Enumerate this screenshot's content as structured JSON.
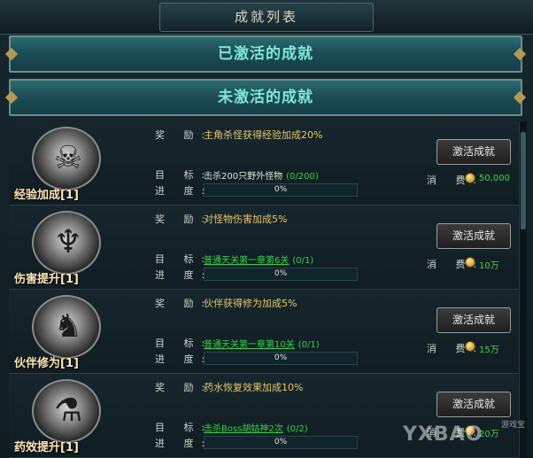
{
  "window": {
    "title": "成就列表"
  },
  "sections": {
    "activated": "已激活的成就",
    "inactive": "未激活的成就"
  },
  "labels": {
    "reward": "奖 励:",
    "target": "目 标:",
    "progress": "进 度:",
    "cost": "消 费:"
  },
  "achievements": [
    {
      "name": "经验加成[1]",
      "icon": "skull-medal-icon",
      "reward": "主角杀怪获得经验加成20%",
      "target": "击杀200只野外怪物",
      "target_link": false,
      "count": "(0/200)",
      "progress_text": "0%",
      "progress": 0,
      "button": "激活成就",
      "cost": "50,000"
    },
    {
      "name": "伤害提升[1]",
      "icon": "trident-medal-icon",
      "reward": "对怪物伤害加成5%",
      "target": "普通天关第一章第6关",
      "target_link": true,
      "count": "(0/1)",
      "progress_text": "0%",
      "progress": 0,
      "button": "激活成就",
      "cost": "10万"
    },
    {
      "name": "伙伴修为[1]",
      "icon": "companion-medal-icon",
      "reward": "伙伴获得修为加成5%",
      "target": "普通天关第一章第10关",
      "target_link": true,
      "count": "(0/1)",
      "progress_text": "0%",
      "progress": 0,
      "button": "激活成就",
      "cost": "15万"
    },
    {
      "name": "药效提升[1]",
      "icon": "potion-medal-icon",
      "reward": "药水恢复效果加成10%",
      "target": "击杀Boss胡姑神2次",
      "target_link": true,
      "count": "(0/2)",
      "progress_text": "0%",
      "progress": 0,
      "button": "激活成就",
      "cost": "20万"
    }
  ],
  "watermark": {
    "text": "YXBAO",
    "sub": "游戏宝"
  },
  "colors": {
    "accent": "#7fe6d6",
    "reward": "#e7c66a",
    "green": "#39d24b"
  }
}
